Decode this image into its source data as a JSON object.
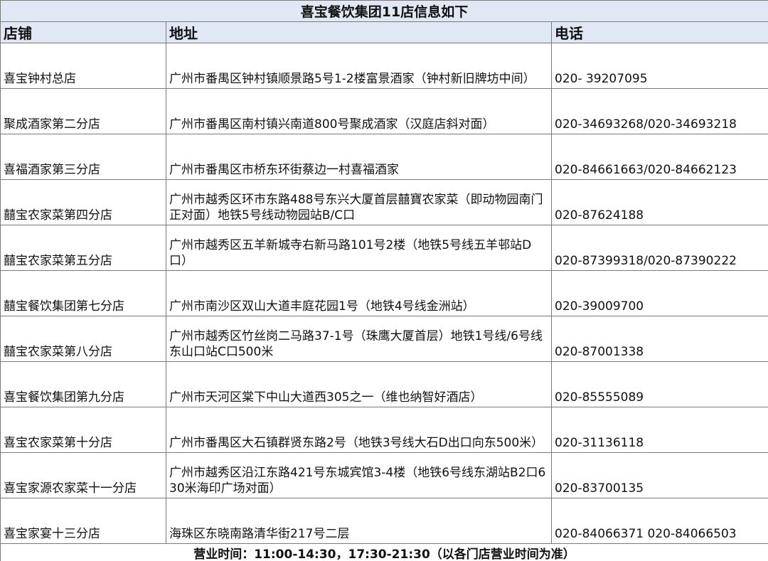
{
  "title": "喜宝餐饮集团11店信息如下",
  "headers": {
    "store": "店铺",
    "address": "地址",
    "phone": "电话"
  },
  "rows": [
    {
      "store": "喜宝钟村总店",
      "address": "广州市番禺区钟村镇顺景路5号1-2楼富景酒家（钟村新旧牌坊中间）",
      "phone": "020- 39207095"
    },
    {
      "store": "聚成酒家第二分店",
      "address": "广州市番禺区南村镇兴南道800号聚成酒家（汉庭店斜对面）",
      "phone": "020-34693268/020-34693218"
    },
    {
      "store": "喜福酒家第三分店",
      "address": "广州市番禺区市桥东环街蔡边一村喜福酒家",
      "phone": "020-84661663/020-84662123"
    },
    {
      "store": "囍宝农家菜第四分店",
      "address": "广州市越秀区环市东路488号东兴大厦首层囍寶农家菜（即动物园南门正对面）地铁5号线动物园站B/C口",
      "phone": "020-87624188"
    },
    {
      "store": "囍宝农家菜第五分店",
      "address": "广州市越秀区五羊新城寺右新马路101号2楼（地铁5号线五羊邨站D口）",
      "phone": "020-87399318/020-87390222"
    },
    {
      "store": "囍宝餐饮集团第七分店",
      "address": "广州市南沙区双山大道丰庭花园1号（地铁4号线金洲站）",
      "phone": "020-39009700"
    },
    {
      "store": "囍宝农家菜第八分店",
      "address": "广州市越秀区竹丝岗二马路37-1号（珠鹰大厦首层）地铁1号线/6号线东山口站C口500米",
      "phone": "020-87001338"
    },
    {
      "store": "喜宝餐饮集团第九分店",
      "address": "广州市天河区棠下中山大道西305之一（维也纳智好酒店）",
      "phone": "020-85555089"
    },
    {
      "store": "喜宝农家菜第十分店",
      "address": "广州市番禺区大石镇群贤东路2号（地铁3号线大石D出口向东500米）",
      "phone": "020-31136118"
    },
    {
      "store": "喜宝家源农家菜十一分店",
      "address": "广州市越秀区沿江东路421号东城宾馆3-4楼（地铁6号线东湖站B2口630米海印广场对面）",
      "phone": "020-83700135"
    },
    {
      "store": "喜宝家宴十三分店",
      "address": "海珠区东晓南路清华街217号二层",
      "phone": "020-84066371 020-84066503"
    }
  ],
  "footer": "营业时间：11:00-14:30，17:30-21:30（以各门店营业时间为准）",
  "colors": {
    "header_bg": "#dfe8f4",
    "border": "#7a7a7a"
  }
}
